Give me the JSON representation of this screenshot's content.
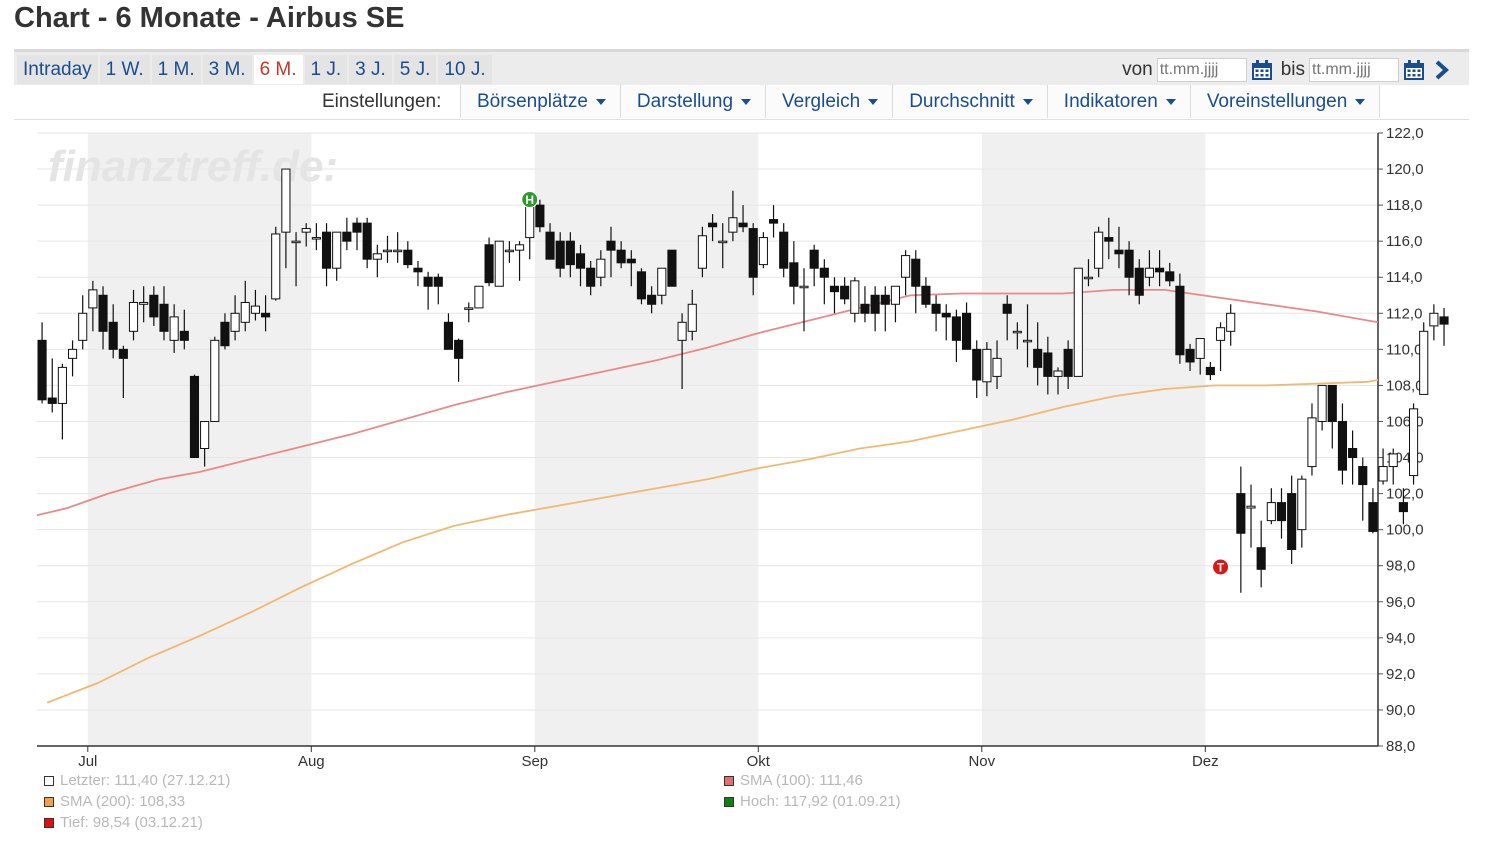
{
  "page_title": "Chart - 6 Monate - Airbus SE",
  "tabs": [
    {
      "label": "Intraday",
      "active": false
    },
    {
      "label": "1 W.",
      "active": false
    },
    {
      "label": "1 M.",
      "active": false
    },
    {
      "label": "3 M.",
      "active": false
    },
    {
      "label": "6 M.",
      "active": true
    },
    {
      "label": "1 J.",
      "active": false
    },
    {
      "label": "3 J.",
      "active": false
    },
    {
      "label": "5 J.",
      "active": false
    },
    {
      "label": "10 J.",
      "active": false
    }
  ],
  "range": {
    "from_label": "von",
    "to_label": "bis",
    "from_placeholder": "tt.mm.jjjj",
    "to_placeholder": "tt.mm.jjjj",
    "calendar_icon": "calendar-icon",
    "next_icon": "chevron-right-icon"
  },
  "settings": {
    "label": "Einstellungen:",
    "menus": [
      "Börsenplätze",
      "Darstellung",
      "Vergleich",
      "Durchschnitt",
      "Indikatoren",
      "Voreinstellungen"
    ]
  },
  "watermark": "finanztreff.de:",
  "colors": {
    "link": "#1a4d8c",
    "active_tab": "#c0392b",
    "sma100": "#e88a8a",
    "sma200": "#f0b870",
    "high_marker": "#2e9a2e",
    "low_marker": "#d81818",
    "shade": "#f0f0f0"
  },
  "legend": [
    {
      "text": "Letzter: 111,40 (27.12.21)",
      "color": "#ffffff"
    },
    {
      "text": "SMA (200): 108,33",
      "color": "#f0a050"
    },
    {
      "text": "Tief: 98,54 (03.12.21)",
      "color": "#e01010"
    },
    {
      "text": "SMA (100): 111,46",
      "color": "#e07070"
    },
    {
      "text": "Hoch: 117,92 (01.09.21)",
      "color": "#108010"
    }
  ],
  "chart_data": {
    "type": "candlestick",
    "ylim": [
      88,
      122
    ],
    "yticks": [
      "88,0",
      "90,0",
      "92,0",
      "94,0",
      "96,0",
      "98,0",
      "100,0",
      "102,0",
      "104,0",
      "106,0",
      "108,0",
      "110,0",
      "112,0",
      "114,0",
      "116,0",
      "118,0",
      "120,0",
      "122,0"
    ],
    "x_labels": [
      "Jul",
      "Aug",
      "Sep",
      "Okt",
      "Nov",
      "Dez"
    ],
    "x_label_index": [
      5,
      27,
      49,
      71,
      93,
      115
    ],
    "shaded_months": [
      [
        5,
        26
      ],
      [
        49,
        70
      ],
      [
        93,
        114
      ]
    ],
    "n_sessions": 132,
    "high_marker": {
      "label": "H",
      "index": 48,
      "value": 117.92
    },
    "low_marker": {
      "label": "T",
      "index": 116,
      "value": 98.54
    },
    "ohlc": [
      [
        110.5,
        111.5,
        107,
        107.2
      ],
      [
        107.3,
        109.5,
        106.5,
        107
      ],
      [
        107,
        109.2,
        105,
        109
      ],
      [
        109.5,
        110.5,
        108.5,
        110
      ],
      [
        110.5,
        113,
        110,
        112
      ],
      [
        112.3,
        113.8,
        111,
        113.3
      ],
      [
        113,
        113.5,
        110,
        111
      ],
      [
        111.5,
        112.5,
        109.5,
        110
      ],
      [
        110,
        110.2,
        107.3,
        109.5
      ],
      [
        111,
        113.3,
        110.5,
        112.6
      ],
      [
        112.5,
        113.5,
        111.5,
        112.6
      ],
      [
        113,
        113.5,
        111.3,
        111.8
      ],
      [
        112.5,
        113.5,
        110.5,
        111
      ],
      [
        110.5,
        112.5,
        109.8,
        111.8
      ],
      [
        111,
        112.2,
        110,
        110.5
      ],
      [
        108.5,
        108.6,
        104,
        104
      ],
      [
        104.5,
        105.5,
        103.5,
        106
      ],
      [
        106,
        110.7,
        106,
        110.5
      ],
      [
        111.5,
        112,
        110,
        110.2
      ],
      [
        111,
        113,
        110.5,
        112
      ],
      [
        111.5,
        113.8,
        111,
        112.6
      ],
      [
        112,
        113.3,
        111.6,
        112.4
      ],
      [
        112,
        113,
        111,
        111.8
      ],
      [
        112.8,
        116.8,
        112.7,
        116.4
      ],
      [
        116.5,
        120,
        114.5,
        120
      ],
      [
        116,
        116.5,
        113.5,
        116
      ],
      [
        116.5,
        117,
        115.7,
        116.7
      ],
      [
        116.2,
        117,
        115.5,
        116.2
      ],
      [
        116.5,
        117,
        113.5,
        114.5
      ],
      [
        114.5,
        116.5,
        113.8,
        116.5
      ],
      [
        116.5,
        117.3,
        115.5,
        116
      ],
      [
        117,
        117.3,
        115.5,
        116.5
      ],
      [
        117,
        117.3,
        114.5,
        115
      ],
      [
        115,
        115.8,
        114,
        115.3
      ],
      [
        115.5,
        116.3,
        114.8,
        115.5
      ],
      [
        115.5,
        116.5,
        114.8,
        115.5
      ],
      [
        115.5,
        116,
        114.5,
        114.7
      ],
      [
        114.5,
        114.9,
        113.5,
        114.3
      ],
      [
        114,
        114.3,
        112.2,
        113.5
      ],
      [
        114,
        114.2,
        112.5,
        113.5
      ],
      [
        111.5,
        112,
        110,
        110
      ],
      [
        110.5,
        110.6,
        108.2,
        109.5
      ],
      [
        112.3,
        112.6,
        111.5,
        112.3
      ],
      [
        112.3,
        113.5,
        112.3,
        113.5
      ],
      [
        115.8,
        116.2,
        113.5,
        113.7
      ],
      [
        113.5,
        116,
        113.5,
        116
      ],
      [
        115.5,
        116,
        114.8,
        115.5
      ],
      [
        115.5,
        116,
        113.8,
        115.8
      ],
      [
        116.2,
        118.4,
        115,
        117.9
      ],
      [
        118,
        118.3,
        116.5,
        116.8
      ],
      [
        116.5,
        117,
        115,
        115
      ],
      [
        116,
        116.5,
        114,
        114.5
      ],
      [
        116,
        116.5,
        114,
        114.7
      ],
      [
        115.3,
        115.8,
        113.5,
        114.5
      ],
      [
        114.5,
        114.9,
        113,
        113.5
      ],
      [
        114,
        115.5,
        113.5,
        115
      ],
      [
        116,
        116.8,
        114,
        115.5
      ],
      [
        115.5,
        116,
        114.5,
        114.8
      ],
      [
        115,
        115.5,
        113.5,
        114.8
      ],
      [
        114.3,
        114.5,
        112.5,
        112.8
      ],
      [
        113,
        113.5,
        112,
        112.5
      ],
      [
        113,
        114.5,
        112.5,
        114.5
      ],
      [
        115.5,
        115.5,
        113.5,
        113.5
      ],
      [
        110.5,
        112,
        107.8,
        111.5
      ],
      [
        111,
        113.3,
        110.5,
        112.5
      ],
      [
        114.5,
        116.8,
        114,
        116.3
      ],
      [
        117,
        117.5,
        116,
        116.8
      ],
      [
        116,
        117,
        114.5,
        116
      ],
      [
        116.5,
        118.8,
        116,
        117.3
      ],
      [
        117,
        118,
        116.5,
        116.8
      ],
      [
        116.7,
        117,
        113,
        114
      ],
      [
        114.7,
        116.5,
        114.5,
        116.2
      ],
      [
        117.2,
        118,
        116.2,
        117
      ],
      [
        116.5,
        117,
        114,
        114.5
      ],
      [
        114.8,
        116,
        112.5,
        113.5
      ],
      [
        113.5,
        114.5,
        111,
        113.5
      ],
      [
        115.5,
        115.8,
        113.5,
        114.5
      ],
      [
        114.5,
        115,
        112.5,
        114
      ],
      [
        113.5,
        114,
        112,
        113.2
      ],
      [
        113.5,
        114,
        112.5,
        112.8
      ],
      [
        112,
        114,
        111.5,
        113.8
      ],
      [
        112.5,
        113.5,
        111.5,
        112
      ],
      [
        113,
        113.5,
        111,
        112
      ],
      [
        113,
        113.5,
        111,
        112.5
      ],
      [
        112.5,
        113.5,
        111.5,
        113.5
      ],
      [
        114,
        115.5,
        113,
        115.2
      ],
      [
        115,
        115.5,
        112,
        113.5
      ],
      [
        113.5,
        114,
        112.3,
        112.5
      ],
      [
        112.5,
        113,
        111,
        112
      ],
      [
        112,
        112.5,
        110.5,
        111.8
      ],
      [
        111.8,
        112.2,
        109.3,
        110.5
      ],
      [
        112,
        112.6,
        110,
        110
      ],
      [
        110,
        110.5,
        107.3,
        108.3
      ],
      [
        108.2,
        110.4,
        107.4,
        110
      ],
      [
        108.5,
        110.5,
        107.8,
        109.5
      ],
      [
        112.5,
        113,
        110.5,
        112
      ],
      [
        111,
        111.5,
        110,
        111
      ],
      [
        110.5,
        112.5,
        109,
        110.5
      ],
      [
        110,
        111.5,
        108,
        109
      ],
      [
        109.8,
        110.7,
        107.5,
        108.5
      ],
      [
        108.5,
        109,
        107.5,
        108.8
      ],
      [
        110,
        110.5,
        107.8,
        108.5
      ],
      [
        108.5,
        114.5,
        108.5,
        114.5
      ],
      [
        114,
        115,
        113.5,
        114
      ],
      [
        114.5,
        116.8,
        114,
        116.5
      ],
      [
        116.2,
        117.3,
        115,
        116
      ],
      [
        115.5,
        116.8,
        114.5,
        115.3
      ],
      [
        115.5,
        116,
        113,
        114
      ],
      [
        114.5,
        115,
        112.5,
        113
      ],
      [
        114,
        115.5,
        113.5,
        114.5
      ],
      [
        114.5,
        115.5,
        113.5,
        114.3
      ],
      [
        114.3,
        114.8,
        113.5,
        113.8
      ],
      [
        113.5,
        114.2,
        109.2,
        109.7
      ],
      [
        110,
        110.3,
        108.8,
        109.3
      ],
      [
        109.5,
        110.5,
        108.6,
        110.6
      ],
      [
        109,
        109.3,
        108.3,
        108.6
      ],
      [
        110.5,
        111.5,
        108.8,
        111.2
      ],
      [
        111,
        112.5,
        110.2,
        112
      ],
      [
        102,
        103.5,
        96.5,
        99.8
      ],
      [
        101.2,
        102.5,
        99,
        101.3
      ],
      [
        99,
        100.5,
        96.8,
        97.8
      ],
      [
        100.5,
        102.3,
        100.3,
        101.5
      ],
      [
        101.5,
        102.3,
        99.5,
        100.5
      ],
      [
        102,
        103,
        98.1,
        98.9
      ],
      [
        100,
        103,
        99,
        102.8
      ],
      [
        103.5,
        107,
        103,
        106.2
      ],
      [
        106,
        108,
        105.5,
        108
      ],
      [
        108,
        108,
        104.5,
        106
      ],
      [
        106,
        107,
        102.5,
        103.3
      ],
      [
        104.5,
        105.5,
        102.5,
        104
      ],
      [
        103.5,
        104,
        100.5,
        102.5
      ],
      [
        101.5,
        102.3,
        99.8,
        99.9
      ],
      [
        102.7,
        104.5,
        102.5,
        103.5
      ],
      [
        103.5,
        104.5,
        102.5,
        104.2
      ],
      [
        101.5,
        102.3,
        100.3,
        101
      ],
      [
        103,
        107,
        102.5,
        106.7
      ],
      [
        107.5,
        111.5,
        107.5,
        111
      ],
      [
        111.3,
        112.5,
        110.5,
        112
      ],
      [
        111.8,
        112.3,
        110.2,
        111.4
      ]
    ],
    "series": [
      {
        "name": "SMA (100)",
        "points": [
          [
            0,
            100.8
          ],
          [
            3,
            101.2
          ],
          [
            7,
            102
          ],
          [
            12,
            102.8
          ],
          [
            16,
            103.2
          ],
          [
            21,
            103.9
          ],
          [
            26,
            104.6
          ],
          [
            31,
            105.3
          ],
          [
            36,
            106.1
          ],
          [
            41,
            106.9
          ],
          [
            46,
            107.6
          ],
          [
            51,
            108.2
          ],
          [
            56,
            108.8
          ],
          [
            61,
            109.4
          ],
          [
            66,
            110.1
          ],
          [
            71,
            110.9
          ],
          [
            76,
            111.6
          ],
          [
            81,
            112.3
          ],
          [
            86,
            113
          ],
          [
            91,
            113.1
          ],
          [
            96,
            113.1
          ],
          [
            101,
            113.1
          ],
          [
            106,
            113.3
          ],
          [
            111,
            113.3
          ],
          [
            116,
            112.9
          ],
          [
            121,
            112.5
          ],
          [
            126,
            112.1
          ],
          [
            131,
            111.6
          ],
          [
            133,
            111.5
          ]
        ]
      },
      {
        "name": "SMA (200)",
        "points": [
          [
            1,
            90.4
          ],
          [
            6,
            91.5
          ],
          [
            11,
            92.9
          ],
          [
            16,
            94.1
          ],
          [
            21,
            95.4
          ],
          [
            26,
            96.8
          ],
          [
            31,
            98.1
          ],
          [
            36,
            99.3
          ],
          [
            41,
            100.2
          ],
          [
            46,
            100.8
          ],
          [
            51,
            101.3
          ],
          [
            56,
            101.8
          ],
          [
            61,
            102.3
          ],
          [
            66,
            102.8
          ],
          [
            71,
            103.4
          ],
          [
            76,
            103.9
          ],
          [
            81,
            104.5
          ],
          [
            86,
            104.9
          ],
          [
            91,
            105.5
          ],
          [
            96,
            106.1
          ],
          [
            101,
            106.8
          ],
          [
            106,
            107.4
          ],
          [
            111,
            107.8
          ],
          [
            116,
            108
          ],
          [
            121,
            108
          ],
          [
            126,
            108.1
          ],
          [
            131,
            108.2
          ],
          [
            133,
            108.3
          ]
        ]
      }
    ]
  }
}
